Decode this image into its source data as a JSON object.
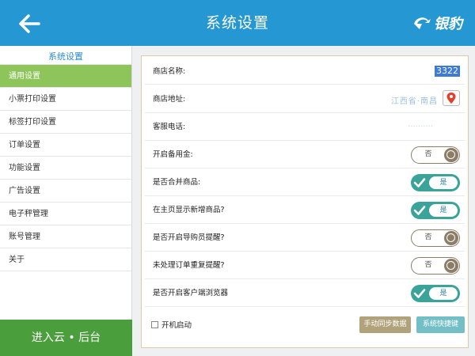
{
  "header": {
    "title": "系统设置",
    "logo_text": "银豹",
    "back_icon": "back-arrow-icon",
    "bg_color": "#2597d3"
  },
  "sidebar": {
    "header": "系统设置",
    "items": [
      {
        "label": "通用设置",
        "active": true
      },
      {
        "label": "小票打印设置"
      },
      {
        "label": "标签打印设置"
      },
      {
        "label": "订单设置"
      },
      {
        "label": "功能设置"
      },
      {
        "label": "广告设置"
      },
      {
        "label": "电子秤管理"
      },
      {
        "label": "账号管理"
      },
      {
        "label": "关于"
      }
    ],
    "enter_cloud": "进入云 • 后台"
  },
  "settings": {
    "store_name": {
      "label": "商店名称:",
      "value": "3322"
    },
    "store_address": {
      "label": "商店地址:",
      "value": "江西省·南昌",
      "icon": "location-pin-icon"
    },
    "service_phone": {
      "label": "客服电话:",
      "value": "··········"
    },
    "toggles": [
      {
        "label": "开启备用金:",
        "state": "否"
      },
      {
        "label": "是否合并商品:",
        "state": "是"
      },
      {
        "label": "在主页显示新增商品?",
        "state": "是"
      },
      {
        "label": "是否开启导购员提醒?",
        "state": "否"
      },
      {
        "label": "未处理订单重复提醒?",
        "state": "否"
      },
      {
        "label": "是否开启客户端浏览器",
        "state": "是"
      }
    ],
    "auto_start": "开机启动",
    "sync_button": "手动同步数据",
    "shortcut_button": "系统快捷键"
  },
  "colors": {
    "active_sidebar": "#8dc55a",
    "enter_cloud": "#4a9e3c",
    "toggle_on": "#3aa39a",
    "toggle_off": "#8d7d67",
    "sync_button": "#b0a27a",
    "shortcut_button": "#74bfc6"
  }
}
